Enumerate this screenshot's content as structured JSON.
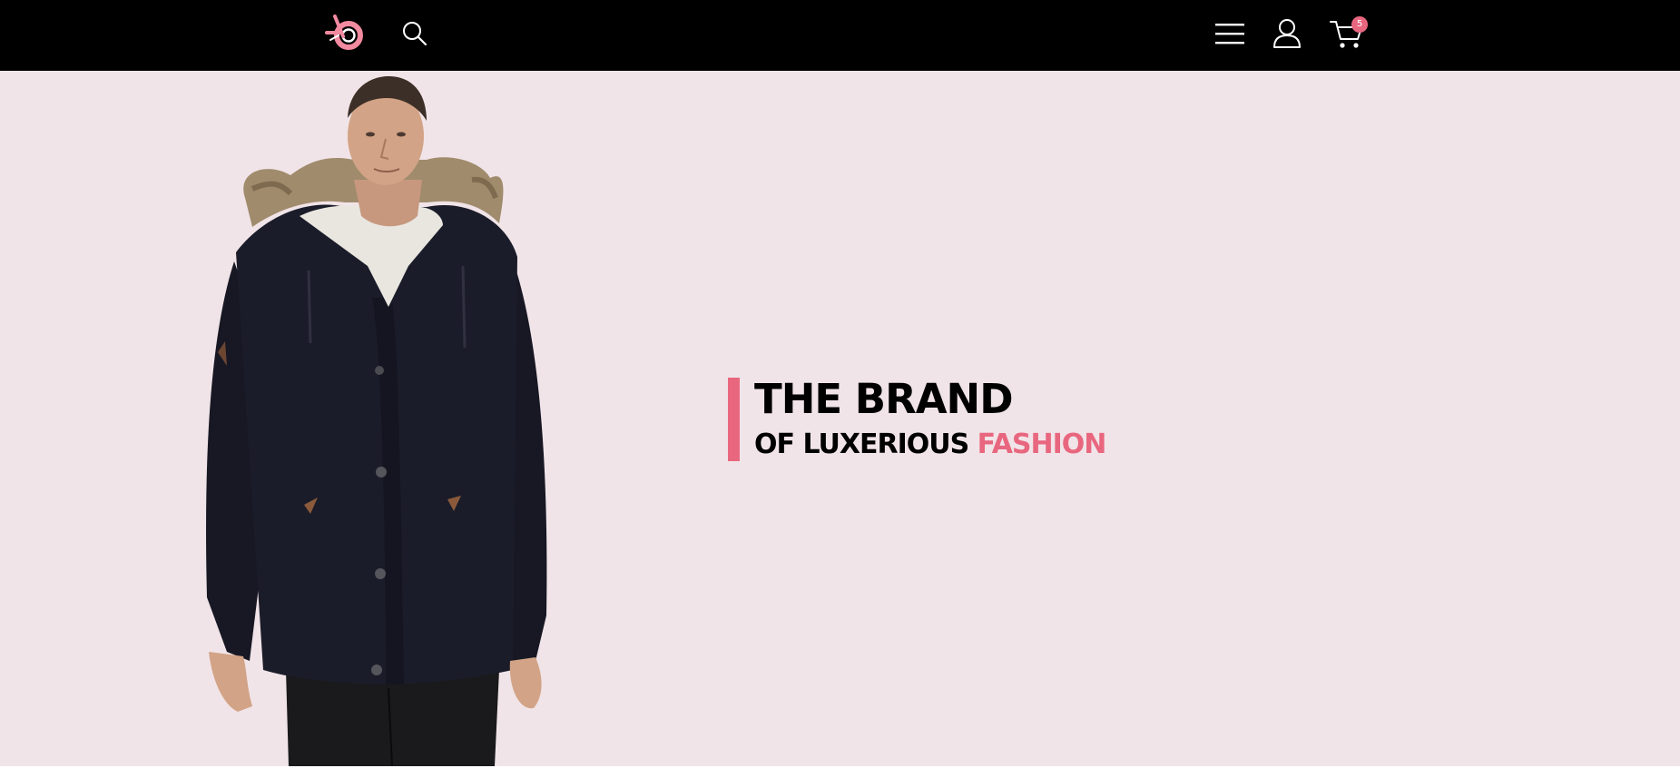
{
  "header": {
    "logo_icon": "brand-logo-icon",
    "search_icon": "search-icon",
    "menu_icon": "hamburger-menu-icon",
    "account_icon": "user-icon",
    "cart_icon": "cart-icon",
    "cart_count": "5"
  },
  "hero": {
    "title": "THE BRAND",
    "subtitle_part1": "OF LUXERIOUS ",
    "subtitle_highlight": "FASHION",
    "image": "model-in-black-parka"
  },
  "colors": {
    "header_bg": "#000000",
    "hero_bg": "#f1e4e8",
    "accent": "#e8677f",
    "text": "#000000"
  }
}
